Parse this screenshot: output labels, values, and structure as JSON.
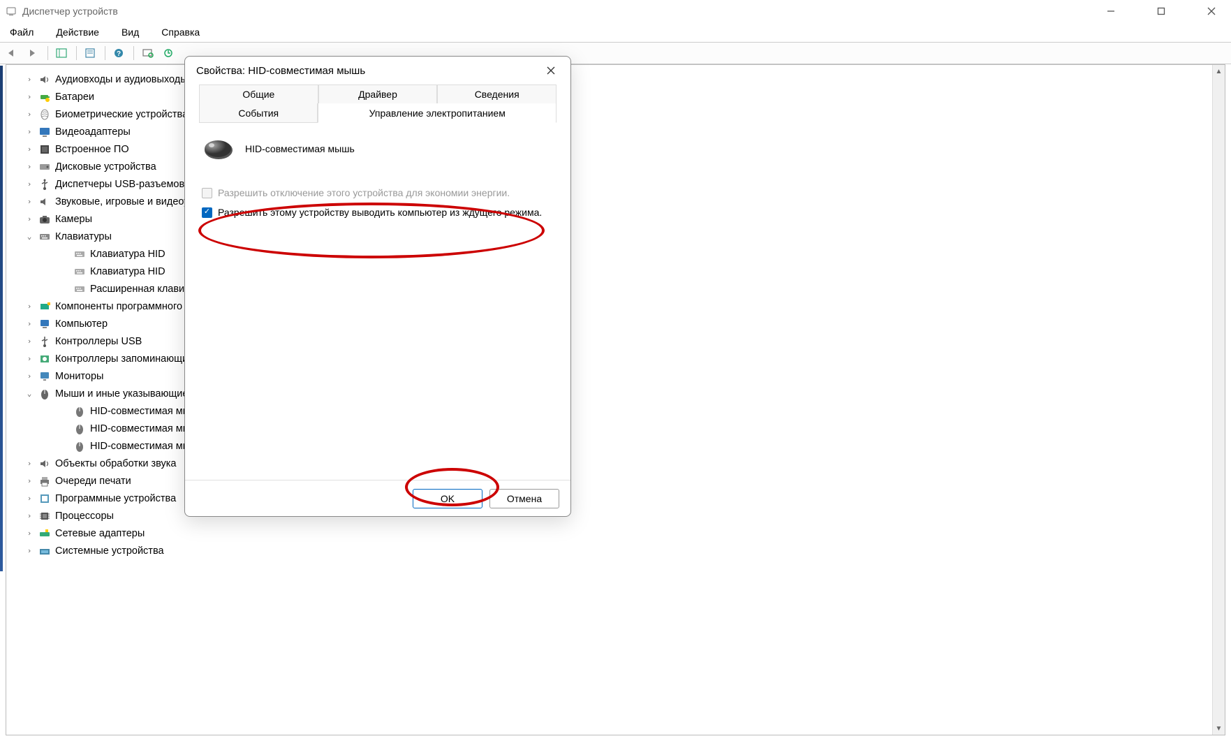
{
  "window": {
    "title": "Диспетчер устройств"
  },
  "menu": {
    "file": "Файл",
    "action": "Действие",
    "view": "Вид",
    "help": "Справка"
  },
  "tree": [
    {
      "expander": ">",
      "icon": "audio",
      "label": "Аудиовходы и аудиовыходы"
    },
    {
      "expander": ">",
      "icon": "battery",
      "label": "Батареи"
    },
    {
      "expander": ">",
      "icon": "biometric",
      "label": "Биометрические устройства"
    },
    {
      "expander": ">",
      "icon": "display",
      "label": "Видеоадаптеры"
    },
    {
      "expander": ">",
      "icon": "firmware",
      "label": "Встроенное ПО"
    },
    {
      "expander": ">",
      "icon": "disk",
      "label": "Дисковые устройства"
    },
    {
      "expander": ">",
      "icon": "usb",
      "label": "Диспетчеры USB-разъемов"
    },
    {
      "expander": ">",
      "icon": "sound",
      "label": "Звуковые, игровые и видеоустройства"
    },
    {
      "expander": ">",
      "icon": "camera",
      "label": "Камеры"
    },
    {
      "expander": "v",
      "icon": "keyboard",
      "label": "Клавиатуры",
      "expanded": true,
      "children": [
        {
          "icon": "kbd-dev",
          "label": "Клавиатура HID"
        },
        {
          "icon": "kbd-dev",
          "label": "Клавиатура HID"
        },
        {
          "icon": "kbd-dev",
          "label": "Расширенная клавиатура"
        }
      ]
    },
    {
      "expander": ">",
      "icon": "component",
      "label": "Компоненты программного обеспечения"
    },
    {
      "expander": ">",
      "icon": "computer",
      "label": "Компьютер"
    },
    {
      "expander": ">",
      "icon": "usb-ctrl",
      "label": "Контроллеры USB"
    },
    {
      "expander": ">",
      "icon": "storage",
      "label": "Контроллеры запоминающих устройств"
    },
    {
      "expander": ">",
      "icon": "monitor",
      "label": "Мониторы"
    },
    {
      "expander": "v",
      "icon": "mouse",
      "label": "Мыши и иные указывающие устройства",
      "expanded": true,
      "children": [
        {
          "icon": "mouse-dev",
          "label": "HID-совместимая мышь"
        },
        {
          "icon": "mouse-dev",
          "label": "HID-совместимая мышь"
        },
        {
          "icon": "mouse-dev",
          "label": "HID-совместимая мышь"
        }
      ]
    },
    {
      "expander": ">",
      "icon": "audio",
      "label": "Объекты обработки звука"
    },
    {
      "expander": ">",
      "icon": "printer",
      "label": "Очереди печати"
    },
    {
      "expander": ">",
      "icon": "software",
      "label": "Программные устройства"
    },
    {
      "expander": ">",
      "icon": "cpu",
      "label": "Процессоры"
    },
    {
      "expander": ">",
      "icon": "network",
      "label": "Сетевые адаптеры"
    },
    {
      "expander": ">",
      "icon": "system",
      "label": "Системные устройства"
    }
  ],
  "dialog": {
    "title": "Свойства: HID-совместимая мышь",
    "tabs": {
      "general": "Общие",
      "driver": "Драйвер",
      "details": "Сведения",
      "events": "События",
      "power": "Управление электропитанием"
    },
    "deviceName": "HID-совместимая мышь",
    "checkbox1": "Разрешить отключение этого устройства для экономии энергии.",
    "checkbox2": "Разрешить этому устройству выводить компьютер из ждущего режима.",
    "ok": "OK",
    "cancel": "Отмена"
  }
}
